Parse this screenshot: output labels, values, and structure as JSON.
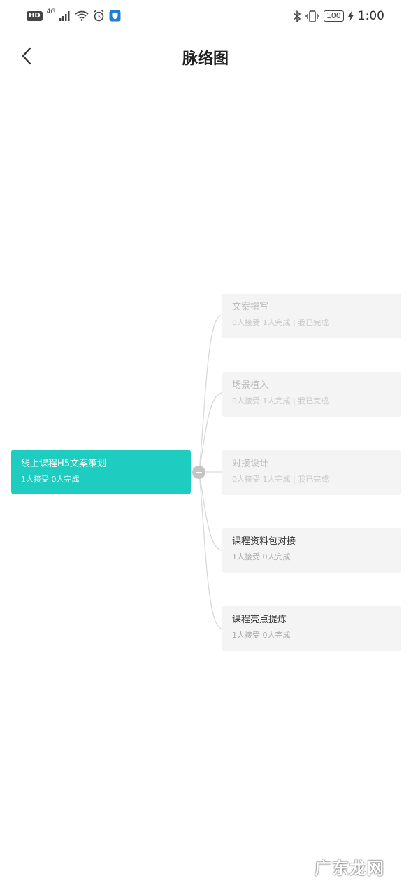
{
  "status_bar": {
    "hd": "HD",
    "network": "4G",
    "battery": "100",
    "time": "1:00"
  },
  "header": {
    "title": "脉络图"
  },
  "mindmap": {
    "root": {
      "title": "线上课程H5文案策划",
      "stats": "1人接受 0人完成"
    },
    "children": [
      {
        "title": "文案撰写",
        "stats": "0人接受 1人完成 | 我已完成",
        "status": "done"
      },
      {
        "title": "场景植入",
        "stats": "0人接受 1人完成 | 我已完成",
        "status": "done"
      },
      {
        "title": "对接设计",
        "stats": "0人接受 1人完成 | 我已完成",
        "status": "done"
      },
      {
        "title": "课程资料包对接",
        "stats": "1人接受 0人完成",
        "status": "open"
      },
      {
        "title": "课程亮点提炼",
        "stats": "1人接受 0人完成",
        "status": "open"
      }
    ]
  },
  "watermark": "广东龙网"
}
